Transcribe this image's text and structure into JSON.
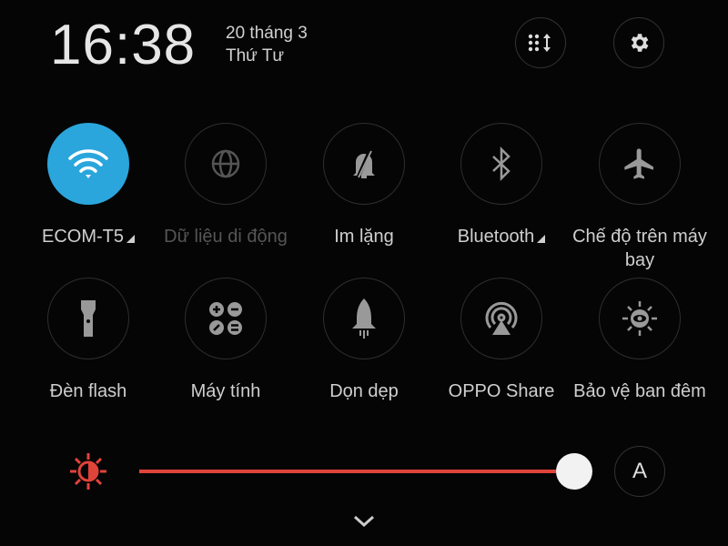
{
  "header": {
    "time": "16:38",
    "date": "20 tháng 3",
    "weekday": "Thứ Tư",
    "edit_icon": "grid-sort-icon",
    "settings_icon": "gear-icon"
  },
  "tiles": [
    {
      "label": "ECOM-T5",
      "icon": "wifi-icon",
      "active": true,
      "expandable": true
    },
    {
      "label": "Dữ liệu di động",
      "icon": "globe-icon",
      "active": false,
      "disabled": true
    },
    {
      "label": "Im lặng",
      "icon": "bell-off-icon",
      "active": false
    },
    {
      "label": "Bluetooth",
      "icon": "bluetooth-icon",
      "active": false,
      "expandable": true
    },
    {
      "label": "Chế độ trên máy bay",
      "icon": "airplane-icon",
      "active": false
    },
    {
      "label": "Đèn flash",
      "icon": "flashlight-icon",
      "active": false
    },
    {
      "label": "Máy tính",
      "icon": "calculator-icon",
      "active": false
    },
    {
      "label": "Dọn dẹp",
      "icon": "rocket-icon",
      "active": false
    },
    {
      "label": "OPPO Share",
      "icon": "share-signal-icon",
      "active": false
    },
    {
      "label": "Bảo vệ ban đêm",
      "icon": "eye-sun-icon",
      "active": false
    }
  ],
  "brightness": {
    "level": 1.0,
    "auto_label": "A",
    "color": "#e0433a"
  },
  "colors": {
    "active": "#2aa6dc",
    "background": "#050505"
  }
}
